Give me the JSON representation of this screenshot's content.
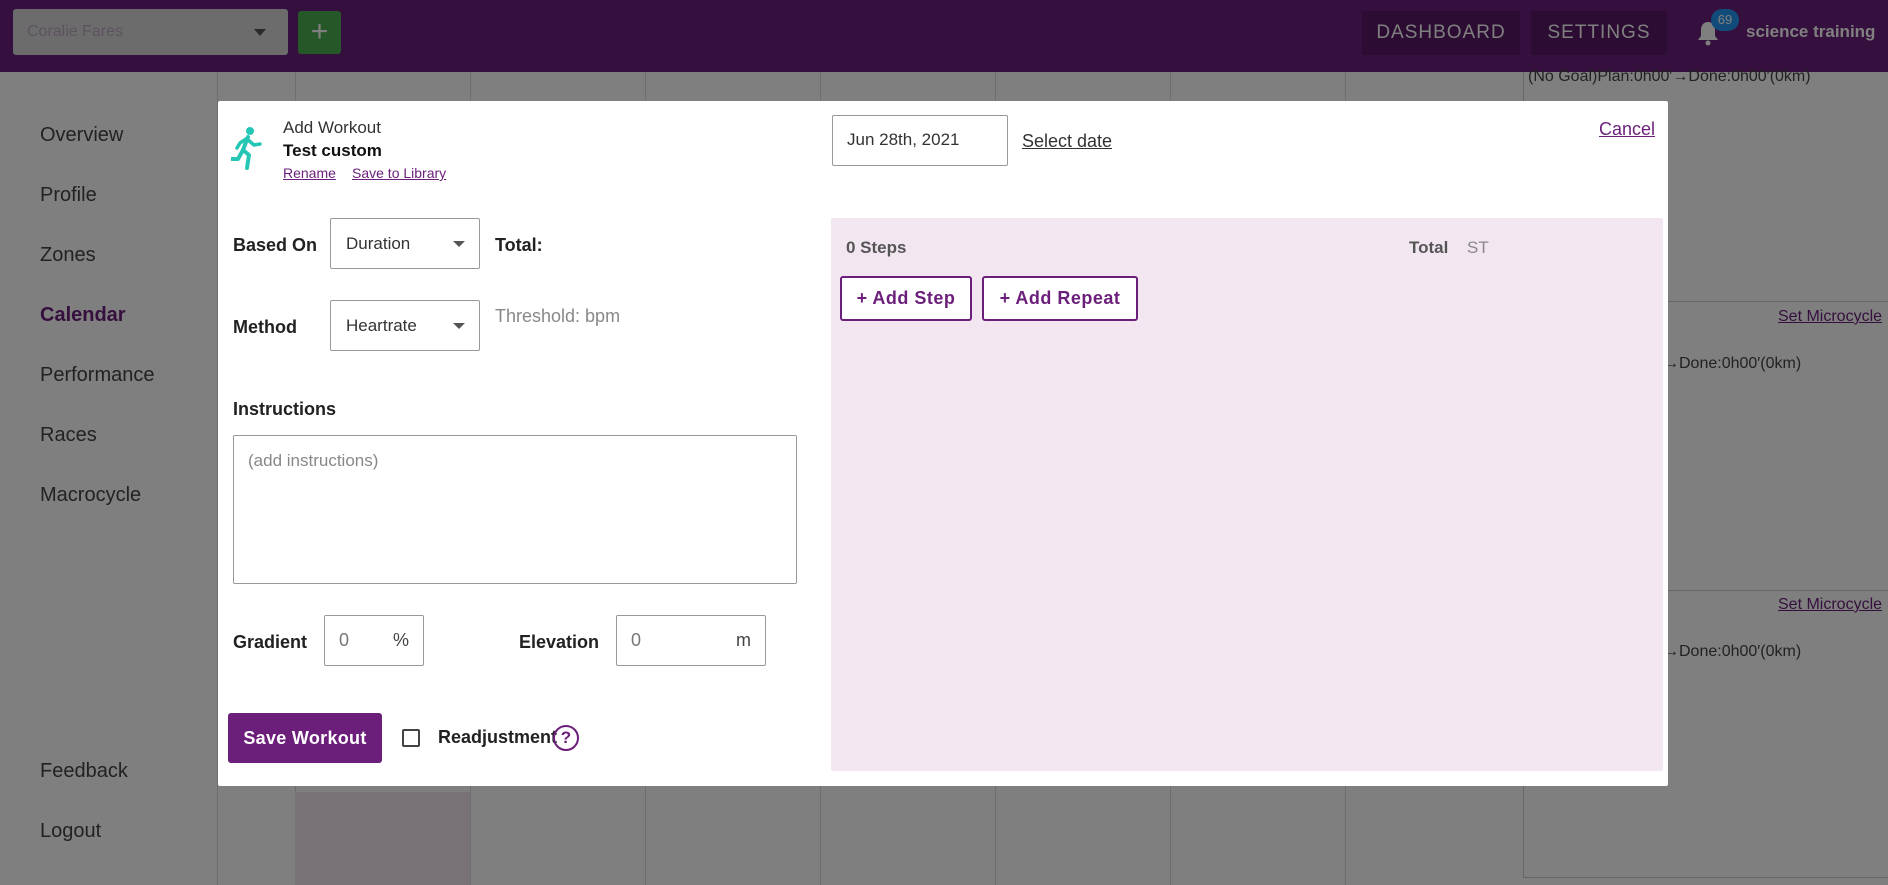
{
  "header": {
    "coach_select_placeholder": "Coralie Fares",
    "add_label": "+",
    "nav": [
      "DASHBOARD",
      "SETTINGS"
    ],
    "notification_count": "69",
    "user_name": "science training"
  },
  "sidebar": {
    "items": [
      "Overview",
      "Profile",
      "Zones",
      "Calendar",
      "Performance",
      "Races",
      "Macrocycle"
    ],
    "active": "Calendar",
    "footer_items": [
      "Feedback",
      "Logout"
    ]
  },
  "calendar": {
    "week_summaries": [
      "(No Goal)Plan:0h00′→Done:0h00′(0km)",
      "′→Done:0h00′(0km)",
      "′→Done:0h00′(0km)"
    ],
    "set_microcycle_label": "Set Microcycle"
  },
  "modal": {
    "heading": "Add Workout",
    "workout_name": "Test custom",
    "rename_label": "Rename",
    "save_to_library_label": "Save to Library",
    "date_value": "Jun 28th, 2021",
    "select_date_label": "Select date",
    "cancel_label": "Cancel",
    "based_on_label": "Based On",
    "based_on_value": "Duration",
    "total_label": "Total:",
    "method_label": "Method",
    "method_value": "Heartrate",
    "threshold_text": "Threshold: bpm",
    "instructions_label": "Instructions",
    "instructions_placeholder": "(add instructions)",
    "gradient_label": "Gradient",
    "gradient_value": "0",
    "gradient_unit": "%",
    "elevation_label": "Elevation",
    "elevation_value": "0",
    "elevation_unit": "m",
    "save_button_label": "Save Workout",
    "readjustment_label": "Readjustment",
    "readjustment_checked": false,
    "help_symbol": "?",
    "steps_count": "0 Steps",
    "steps_total_label": "Total",
    "steps_total_unit": "ST",
    "add_step_label": "+ Add Step",
    "add_repeat_label": "+ Add Repeat"
  },
  "colors": {
    "brand_purple": "#6b1f7a",
    "add_green": "#4caf50",
    "badge_blue": "#2196f3",
    "steps_panel_bg": "#f2e7f1",
    "runner_icon": "#26c6b5"
  },
  "icons": {
    "runner": "running-person-icon",
    "bell": "bell-icon",
    "help": "question-circle-icon",
    "caret": "chevron-down-icon"
  }
}
